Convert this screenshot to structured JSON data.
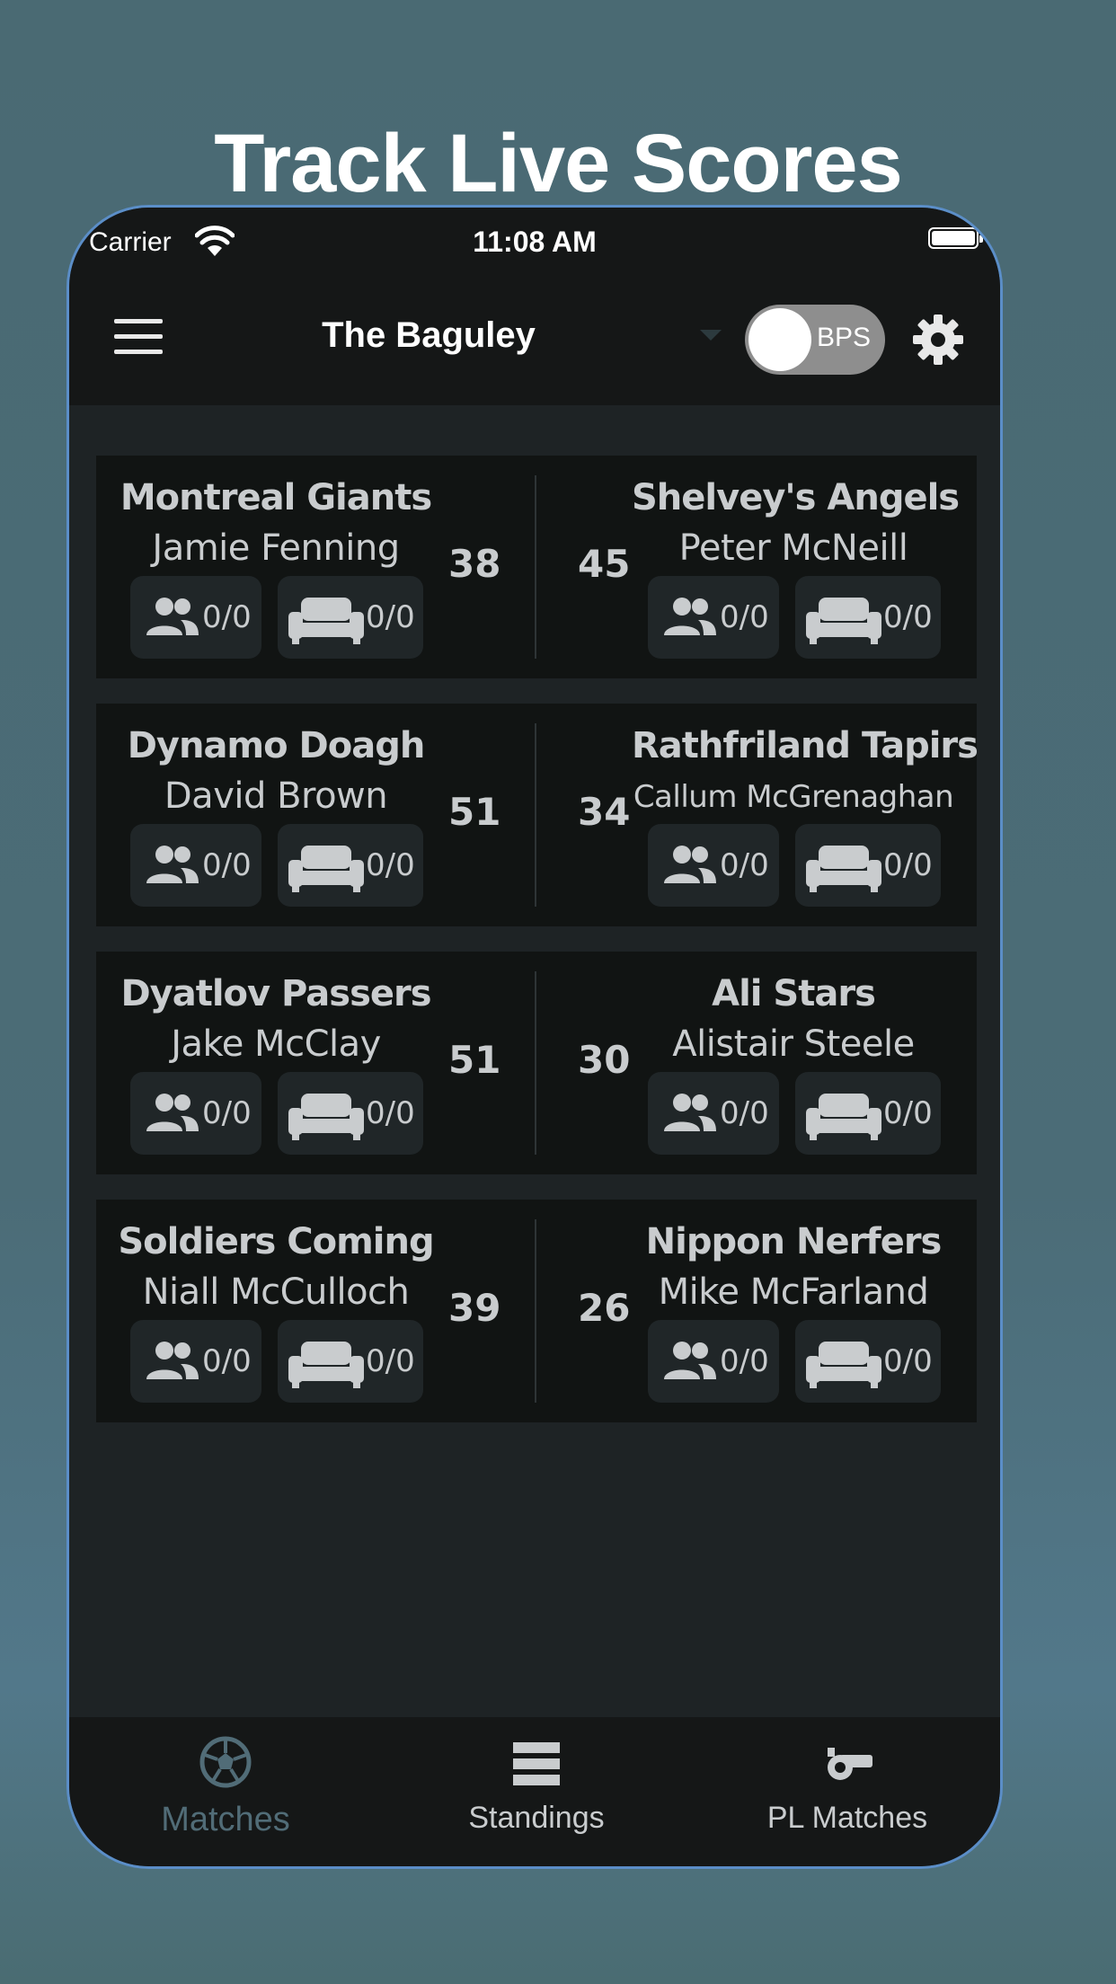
{
  "headline": "Track Live Scores",
  "status_bar": {
    "carrier": "Carrier",
    "time": "11:08 AM"
  },
  "app_bar": {
    "title": "The Baguley",
    "toggle_label": "BPS"
  },
  "matches": [
    {
      "home": {
        "team": "Montreal Giants",
        "manager": "Jamie Fenning",
        "score": "38",
        "players": "0/0",
        "bench": "0/0"
      },
      "away": {
        "team": "Shelvey's Angels",
        "manager": "Peter McNeill",
        "score": "45",
        "players": "0/0",
        "bench": "0/0"
      }
    },
    {
      "home": {
        "team": "Dynamo Doagh",
        "manager": "David Brown",
        "score": "51",
        "players": "0/0",
        "bench": "0/0"
      },
      "away": {
        "team": "Rathfriland Tapirs",
        "manager": "Callum McGrenaghan",
        "score": "34",
        "players": "0/0",
        "bench": "0/0"
      }
    },
    {
      "home": {
        "team": "Dyatlov Passers",
        "manager": "Jake McClay",
        "score": "51",
        "players": "0/0",
        "bench": "0/0"
      },
      "away": {
        "team": "Ali Stars",
        "manager": "Alistair Steele",
        "score": "30",
        "players": "0/0",
        "bench": "0/0"
      }
    },
    {
      "home": {
        "team": "Soldiers Coming",
        "manager": "Niall McCulloch",
        "score": "39",
        "players": "0/0",
        "bench": "0/0"
      },
      "away": {
        "team": "Nippon Nerfers",
        "manager": "Mike McFarland",
        "score": "26",
        "players": "0/0",
        "bench": "0/0"
      }
    }
  ],
  "tabs": [
    {
      "label": "Matches",
      "icon": "soccer-ball-icon",
      "active": true
    },
    {
      "label": "Standings",
      "icon": "standings-list-icon",
      "active": false
    },
    {
      "label": "PL Matches",
      "icon": "whistle-icon",
      "active": false
    }
  ],
  "colors": {
    "active_tab": "#516c77",
    "text": "#c9ccce",
    "card": "#111413",
    "stat_chip": "#202628"
  }
}
